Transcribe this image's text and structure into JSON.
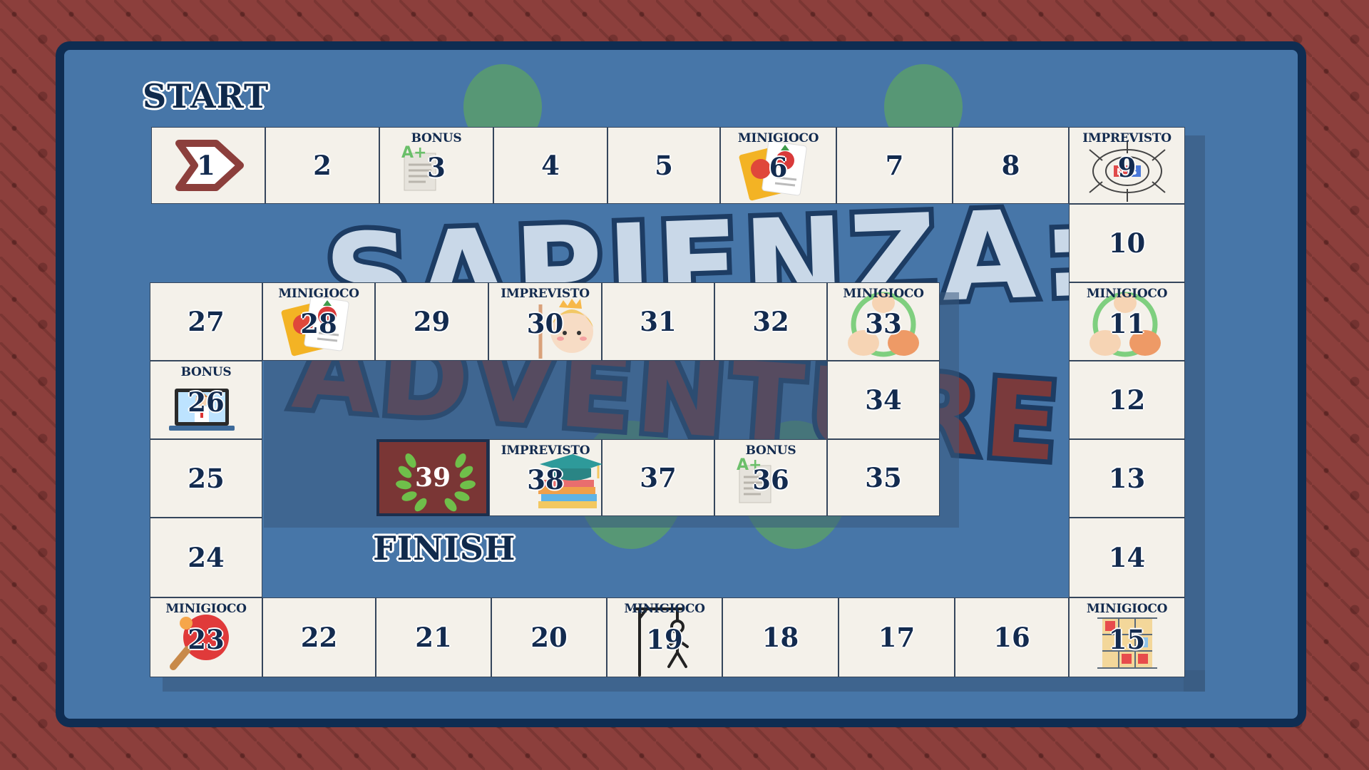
{
  "title": {
    "line1": "SAPIENZA:",
    "line2": "ADVENTURE"
  },
  "labels": {
    "start": "START",
    "finish": "FINISH"
  },
  "cell_types": {
    "minigioco": "MINIGIOCO",
    "bonus": "BONUS",
    "imprevisto": "IMPREVISTO"
  },
  "cells": {
    "1": {
      "number": "1",
      "type": "",
      "icon": "start-arrow-icon"
    },
    "2": {
      "number": "2",
      "type": ""
    },
    "3": {
      "number": "3",
      "type": "BONUS",
      "icon": "a-plus-paper-icon"
    },
    "4": {
      "number": "4",
      "type": ""
    },
    "5": {
      "number": "5",
      "type": ""
    },
    "6": {
      "number": "6",
      "type": "MINIGIOCO",
      "icon": "fruit-cards-icon"
    },
    "7": {
      "number": "7",
      "type": ""
    },
    "8": {
      "number": "8",
      "type": ""
    },
    "9": {
      "number": "9",
      "type": "IMPREVISTO",
      "icon": "magnet-field-icon"
    },
    "10": {
      "number": "10",
      "type": ""
    },
    "11": {
      "number": "11",
      "type": "MINIGIOCO",
      "icon": "rock-paper-scissors-icon"
    },
    "12": {
      "number": "12",
      "type": ""
    },
    "13": {
      "number": "13",
      "type": ""
    },
    "14": {
      "number": "14",
      "type": ""
    },
    "15": {
      "number": "15",
      "type": "MINIGIOCO",
      "icon": "tic-tac-toe-icon"
    },
    "16": {
      "number": "16",
      "type": ""
    },
    "17": {
      "number": "17",
      "type": ""
    },
    "18": {
      "number": "18",
      "type": ""
    },
    "19": {
      "number": "19",
      "type": "MINIGIOCO",
      "icon": "hangman-icon"
    },
    "20": {
      "number": "20",
      "type": ""
    },
    "21": {
      "number": "21",
      "type": ""
    },
    "22": {
      "number": "22",
      "type": ""
    },
    "23": {
      "number": "23",
      "type": "MINIGIOCO",
      "icon": "ping-pong-icon"
    },
    "24": {
      "number": "24",
      "type": ""
    },
    "25": {
      "number": "25",
      "type": ""
    },
    "26": {
      "number": "26",
      "type": "BONUS",
      "icon": "online-teacher-icon"
    },
    "27": {
      "number": "27",
      "type": ""
    },
    "28": {
      "number": "28",
      "type": "MINIGIOCO",
      "icon": "fruit-cards-icon"
    },
    "29": {
      "number": "29",
      "type": ""
    },
    "30": {
      "number": "30",
      "type": "IMPREVISTO",
      "icon": "girl-character-icon"
    },
    "31": {
      "number": "31",
      "type": ""
    },
    "32": {
      "number": "32",
      "type": ""
    },
    "33": {
      "number": "33",
      "type": "MINIGIOCO",
      "icon": "rock-paper-scissors-icon"
    },
    "34": {
      "number": "34",
      "type": ""
    },
    "35": {
      "number": "35",
      "type": ""
    },
    "36": {
      "number": "36",
      "type": "BONUS",
      "icon": "a-plus-paper-icon"
    },
    "37": {
      "number": "37",
      "type": ""
    },
    "38": {
      "number": "38",
      "type": "IMPREVISTO",
      "icon": "graduation-books-icon"
    },
    "39": {
      "number": "39",
      "type": "",
      "icon": "laurel-wreath-icon"
    }
  },
  "colors": {
    "board": "#4776a8",
    "frame": "#0f2d52",
    "background": "#8c3f3c",
    "cell": "#f4f1ea",
    "finish_cell": "#7a3635",
    "text": "#132b4f"
  }
}
